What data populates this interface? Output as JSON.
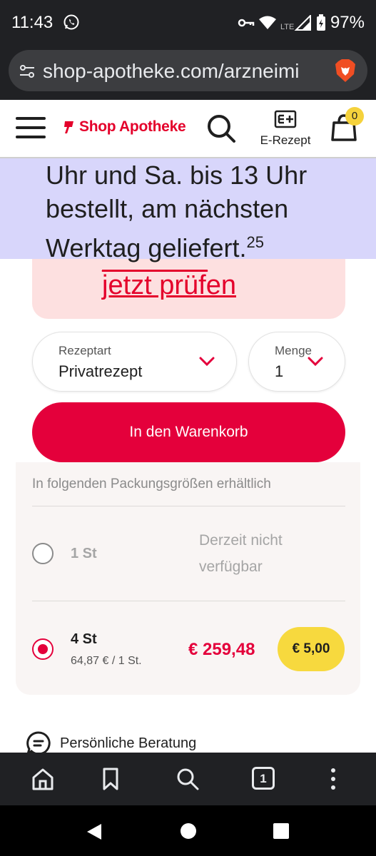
{
  "status_bar": {
    "time": "11:43",
    "battery": "97%"
  },
  "browser": {
    "url": "shop-apotheke.com/arzneimi"
  },
  "header": {
    "brand": "Shop Apotheke",
    "erezept_label": "E-Rezept",
    "cart_count": "0"
  },
  "banner": {
    "line1": "Uhr und Sa. bis 13 Uhr",
    "line2": "bestellt, am nächsten",
    "line3": "Werktag geliefert.",
    "footnote": "25"
  },
  "alert": {
    "link_text": "jetzt prüfen"
  },
  "rezeptart": {
    "caption": "Rezeptart",
    "value": "Privatrezept"
  },
  "menge": {
    "caption": "Menge",
    "value": "1"
  },
  "add_to_cart": {
    "label": "In den Warenkorb"
  },
  "pack_sizes": {
    "header": "In folgenden Packungsgrößen erhältlich",
    "options": [
      {
        "size": "1 St",
        "status_line1": "Derzeit nicht",
        "status_line2": "verfügbar",
        "selected": false
      },
      {
        "size": "4 St",
        "unit_price": "64,87 € / 1 St.",
        "price": "€ 259,48",
        "promo": "€ 5,00",
        "selected": true
      }
    ]
  },
  "beratung": {
    "label": "Persönliche Beratung"
  },
  "bottom_toolbar": {
    "tab_count": "1"
  },
  "colors": {
    "brand_red": "#e4003b",
    "banner_purple": "#d8d6fb",
    "promo_yellow": "#f7d93e",
    "alert_pink": "#fde0e0"
  }
}
